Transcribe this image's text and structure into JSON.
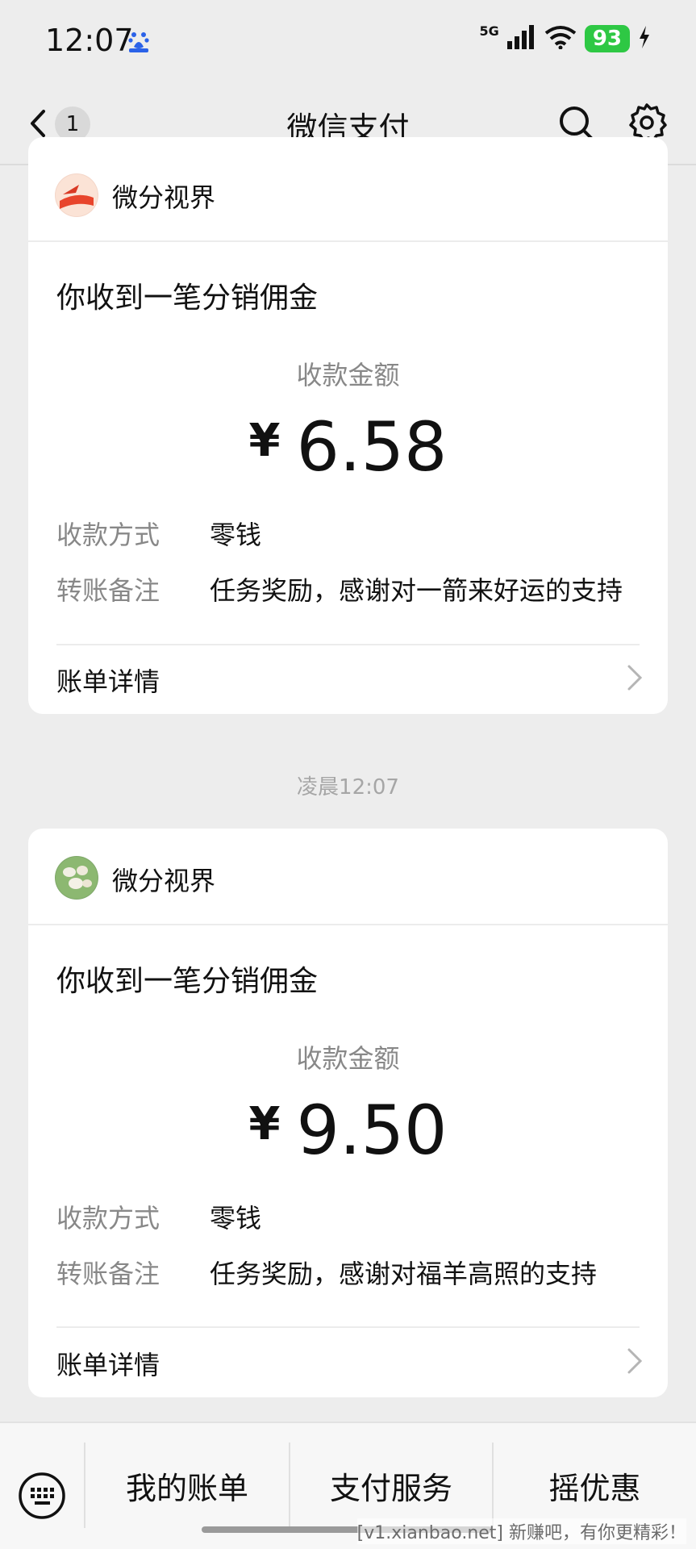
{
  "status_bar": {
    "time": "12:07",
    "network": "5G",
    "battery": "93"
  },
  "nav": {
    "unread_count": "1",
    "title": "微信支付"
  },
  "cards": [
    {
      "merchant": "微分视界",
      "title": "你收到一笔分销佣金",
      "amount_label": "收款金额",
      "currency": "¥",
      "amount": "6.58",
      "method_label": "收款方式",
      "method_value": "零钱",
      "note_label": "转账备注",
      "note_value": "任务奖励，感谢对一箭来好运的支持",
      "detail_label": "账单详情"
    },
    {
      "merchant": "微分视界",
      "title": "你收到一笔分销佣金",
      "amount_label": "收款金额",
      "currency": "¥",
      "amount": "9.50",
      "method_label": "收款方式",
      "method_value": "零钱",
      "note_label": "转账备注",
      "note_value": "任务奖励，感谢对福羊高照的支持",
      "detail_label": "账单详情"
    }
  ],
  "timestamp": "凌晨12:07",
  "bottom_menu": {
    "items": [
      "我的账单",
      "支付服务",
      "摇优惠"
    ]
  },
  "watermark": "[v1.xianbao.net] 新赚吧，有你更精彩！",
  "colors": {
    "background": "#ededed",
    "card": "#ffffff",
    "battery_green": "#2ec844",
    "muted_text": "#888888"
  }
}
